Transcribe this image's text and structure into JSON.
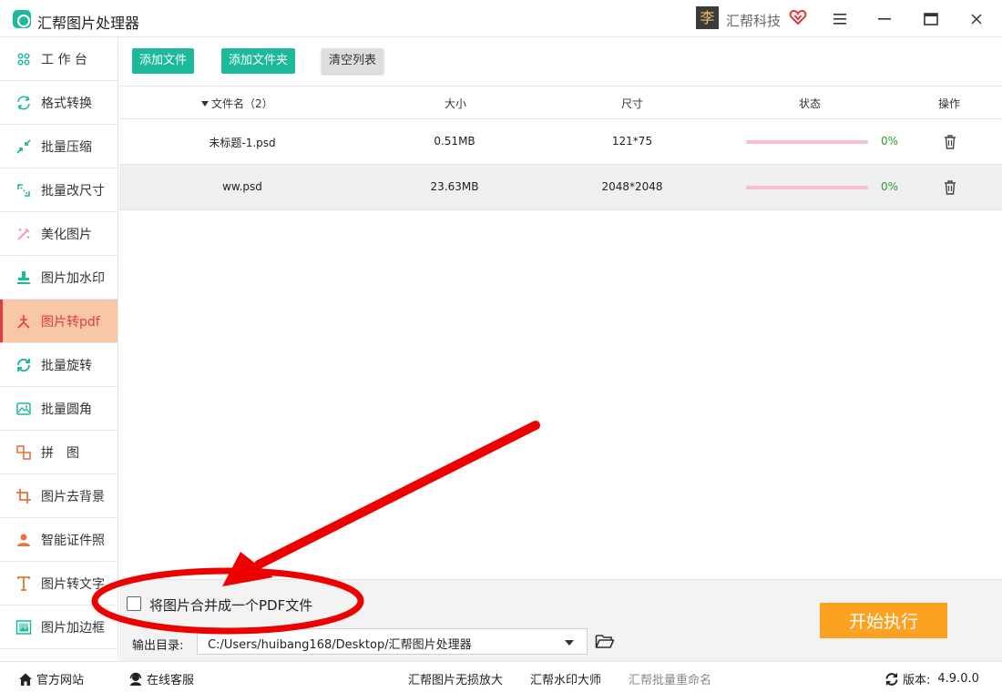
{
  "window": {
    "title": "汇帮图片处理器",
    "user_name": "汇帮科技",
    "user_avatar_char": "李"
  },
  "sidebar": {
    "items": [
      {
        "label": "工 作 台",
        "icon": "grid-icon"
      },
      {
        "label": "格式转换",
        "icon": "convert-icon"
      },
      {
        "label": "批量压缩",
        "icon": "compress-icon"
      },
      {
        "label": "批量改尺寸",
        "icon": "resize-icon"
      },
      {
        "label": "美化图片",
        "icon": "beautify-icon"
      },
      {
        "label": "图片加水印",
        "icon": "watermark-icon"
      },
      {
        "label": "图片转pdf",
        "icon": "pdf-icon",
        "active": true
      },
      {
        "label": "批量旋转",
        "icon": "rotate-icon"
      },
      {
        "label": "批量圆角",
        "icon": "rounded-corner-icon"
      },
      {
        "label": "拼　图",
        "icon": "collage-icon"
      },
      {
        "label": "图片去背景",
        "icon": "crop-icon"
      },
      {
        "label": "智能证件照",
        "icon": "person-icon"
      },
      {
        "label": "图片转文字",
        "icon": "text-icon"
      },
      {
        "label": "图片加边框",
        "icon": "frame-icon"
      }
    ]
  },
  "toolbar": {
    "add_file": "添加文件",
    "add_folder": "添加文件夹",
    "clear_list": "清空列表"
  },
  "table": {
    "headers": {
      "name": "文件名（2）",
      "size": "大小",
      "dimensions": "尺寸",
      "status": "状态",
      "operation": "操作"
    },
    "rows": [
      {
        "name": "未标题-1.psd",
        "size": "0.51MB",
        "dimensions": "121*75",
        "progress": 0,
        "progress_label": "0%"
      },
      {
        "name": "ww.psd",
        "size": "23.63MB",
        "dimensions": "2048*2048",
        "progress": 0,
        "progress_label": "0%"
      }
    ]
  },
  "options": {
    "merge_pdf_label": "将图片合并成一个PDF文件",
    "merge_pdf_checked": false,
    "output_label": "输出目录:",
    "output_path": "C:/Users/huibang168/Desktop/汇帮图片处理器",
    "start_button": "开始执行"
  },
  "statusbar": {
    "home": "官方网站",
    "service": "在线客服",
    "link1": "汇帮图片无损放大",
    "link2": "汇帮水印大师",
    "link3": "汇帮批量重命名",
    "version_label": "版本:",
    "version": "4.9.0.0"
  },
  "colors": {
    "accent_green": "#1db99b",
    "start_orange": "#fba223",
    "active_bg": "#f8c7a5",
    "active_text": "#e23b3b",
    "annotation_red": "#ee0000"
  }
}
